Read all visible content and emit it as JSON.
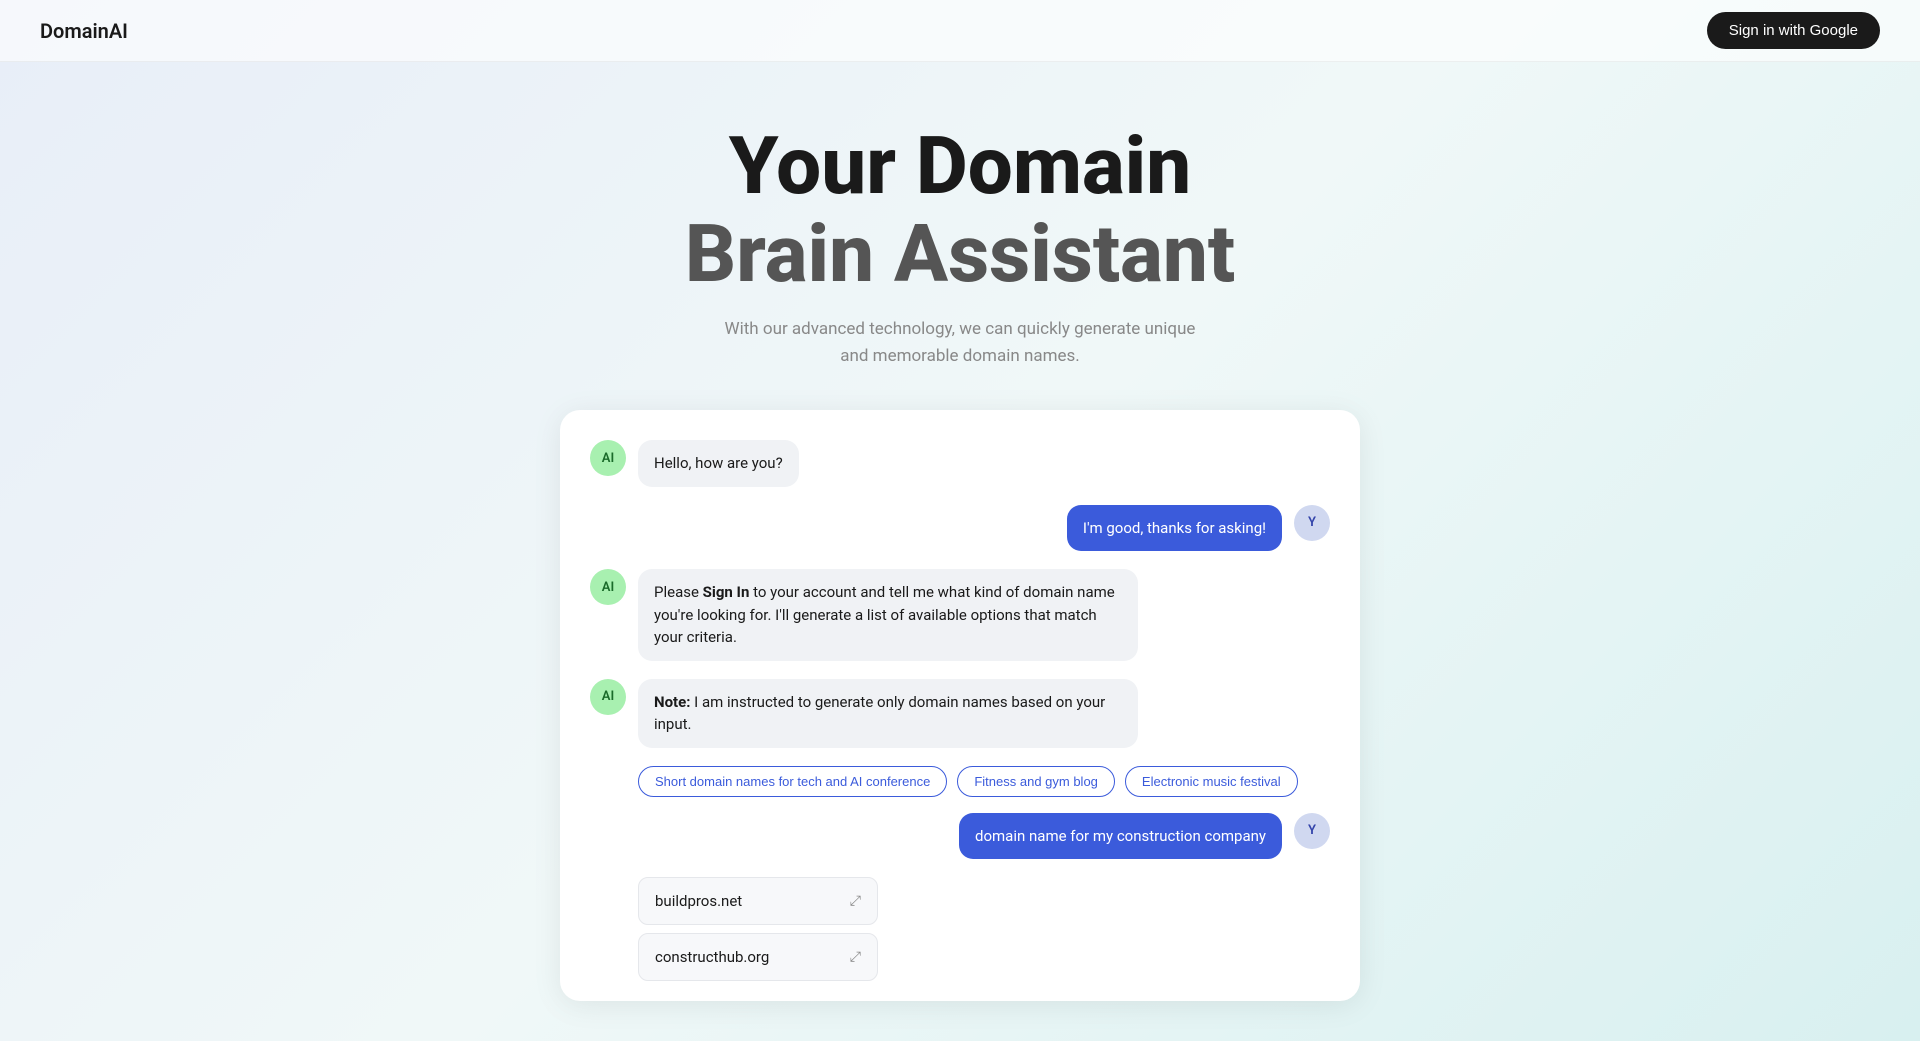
{
  "header": {
    "logo": "DomainAI",
    "sign_in_label": "Sign in with Google"
  },
  "hero": {
    "title_line1": "Your Domain",
    "title_line2": "Brain Assistant",
    "subtitle_line1": "With our advanced technology, we can quickly generate unique",
    "subtitle_line2": "and memorable domain names."
  },
  "chat": {
    "messages": [
      {
        "id": "msg1",
        "sender": "ai",
        "avatar_label": "AI",
        "text": "Hello, how are you?"
      },
      {
        "id": "msg2",
        "sender": "user",
        "avatar_label": "Y",
        "text": "I'm good, thanks for asking!"
      },
      {
        "id": "msg3",
        "sender": "ai",
        "avatar_label": "AI",
        "text_bold": "Sign In",
        "text_before": "Please ",
        "text_after": " to your account and tell me what kind of domain name you're looking for. I'll generate a list of available options that match your criteria."
      },
      {
        "id": "msg4",
        "sender": "ai",
        "avatar_label": "AI",
        "text_bold": "Note:",
        "text_before": "",
        "text_after": " I am instructed to generate only domain names based on your input."
      }
    ],
    "chips": [
      "Short domain names for tech and AI conference",
      "Fitness and gym blog",
      "Electronic music festival"
    ],
    "user_message2": {
      "sender": "user",
      "avatar_label": "Y",
      "text": "domain name for my construction company"
    },
    "domain_results": [
      {
        "name": "buildpros.net"
      },
      {
        "name": "constructhub.org"
      }
    ]
  }
}
